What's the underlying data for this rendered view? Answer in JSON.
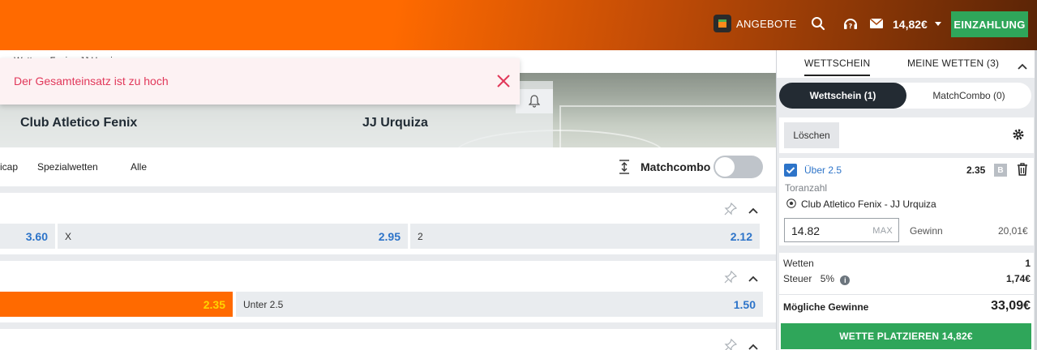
{
  "header": {
    "offers_label": "ANGEBOTE",
    "balance": "14,82€",
    "deposit_label": "EINZAHLUNG"
  },
  "breadcrumb": "... Wetten · Fenix · JJ Urquiza",
  "toast": {
    "message": "Der Gesamteinsatz ist zu hoch"
  },
  "event": {
    "home_team": "Club Atletico Fenix",
    "away_team": "JJ Urquiza"
  },
  "market_tabs": [
    "icap",
    "Spezialwetten",
    "Alle"
  ],
  "matchcombo": {
    "label": "Matchcombo",
    "enabled": false
  },
  "markets": [
    {
      "odds": [
        {
          "label": "",
          "value": "3.60"
        },
        {
          "label": "X",
          "value": "2.95"
        },
        {
          "label": "2",
          "value": "2.12"
        }
      ]
    },
    {
      "odds": [
        {
          "label": "",
          "value": "2.35",
          "selected": true
        },
        {
          "label": "Unter 2.5",
          "value": "1.50"
        }
      ]
    }
  ],
  "betslip": {
    "tabs": [
      "WETTSCHEIN",
      "MEINE WETTEN (3)"
    ],
    "segments": [
      "Wettschein (1)",
      "MatchCombo (0)"
    ],
    "clear_label": "Löschen",
    "bet": {
      "selection": "Über 2.5",
      "odd": "2.35",
      "boost_badge": "B",
      "market": "Toranzahl",
      "match": "Club Atletico Fenix - JJ Urquiza",
      "stake": "14.82",
      "max_label": "MAX",
      "win_label": "Gewinn",
      "win_value": "20,01€"
    },
    "summary": {
      "bets_label": "Wetten",
      "bets_value": "1",
      "tax_label": "Steuer",
      "tax_rate": "5%",
      "tax_value": "1,74€",
      "possible_win_label": "Mögliche Gewinne",
      "possible_win_value": "33,09€"
    },
    "place_label": "WETTE PLATZIEREN 14,82€"
  },
  "colors": {
    "brand_orange": "#ff6a00",
    "green": "#2fa65a",
    "odds_blue": "#2d74c9",
    "error_red": "#e1385a",
    "dark": "#232b33"
  }
}
